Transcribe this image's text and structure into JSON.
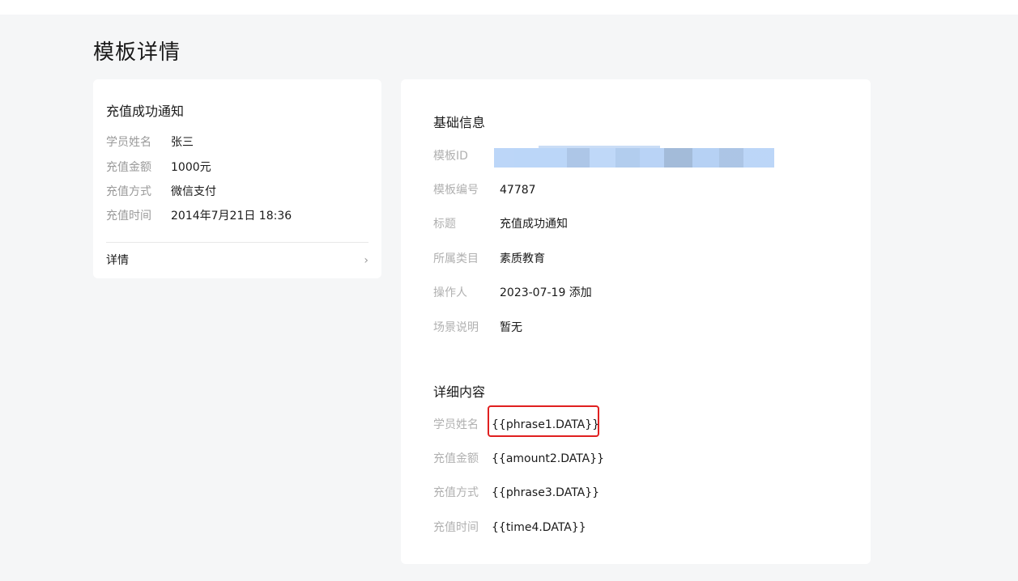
{
  "page": {
    "title": "模板详情"
  },
  "preview": {
    "title": "充值成功通知",
    "rows": [
      {
        "label": "学员姓名",
        "value": "张三"
      },
      {
        "label": "充值金额",
        "value": "1000元"
      },
      {
        "label": "充值方式",
        "value": "微信支付"
      },
      {
        "label": "充值时间",
        "value": "2014年7月21日 18:36"
      }
    ],
    "detail_link": "详情",
    "chevron": "›"
  },
  "basic_info": {
    "title": "基础信息",
    "template_id_label": "模板ID",
    "rows": [
      {
        "label": "模板编号",
        "value": "47787"
      },
      {
        "label": "标题",
        "value": "充值成功通知"
      },
      {
        "label": "所属类目",
        "value": "素质教育"
      },
      {
        "label": "操作人",
        "value": "2023-07-19 添加"
      },
      {
        "label": "场景说明",
        "value": "暂无"
      }
    ]
  },
  "detail_content": {
    "title": "详细内容",
    "rows": [
      {
        "label": "学员姓名",
        "value": "{{phrase1.DATA}}"
      },
      {
        "label": "充值金额",
        "value": "{{amount2.DATA}}"
      },
      {
        "label": "充值方式",
        "value": "{{phrase3.DATA}}"
      },
      {
        "label": "充值时间",
        "value": "{{time4.DATA}}"
      }
    ]
  },
  "colors": {
    "highlight": "#e02020",
    "redaction": "#b8d4f8"
  }
}
